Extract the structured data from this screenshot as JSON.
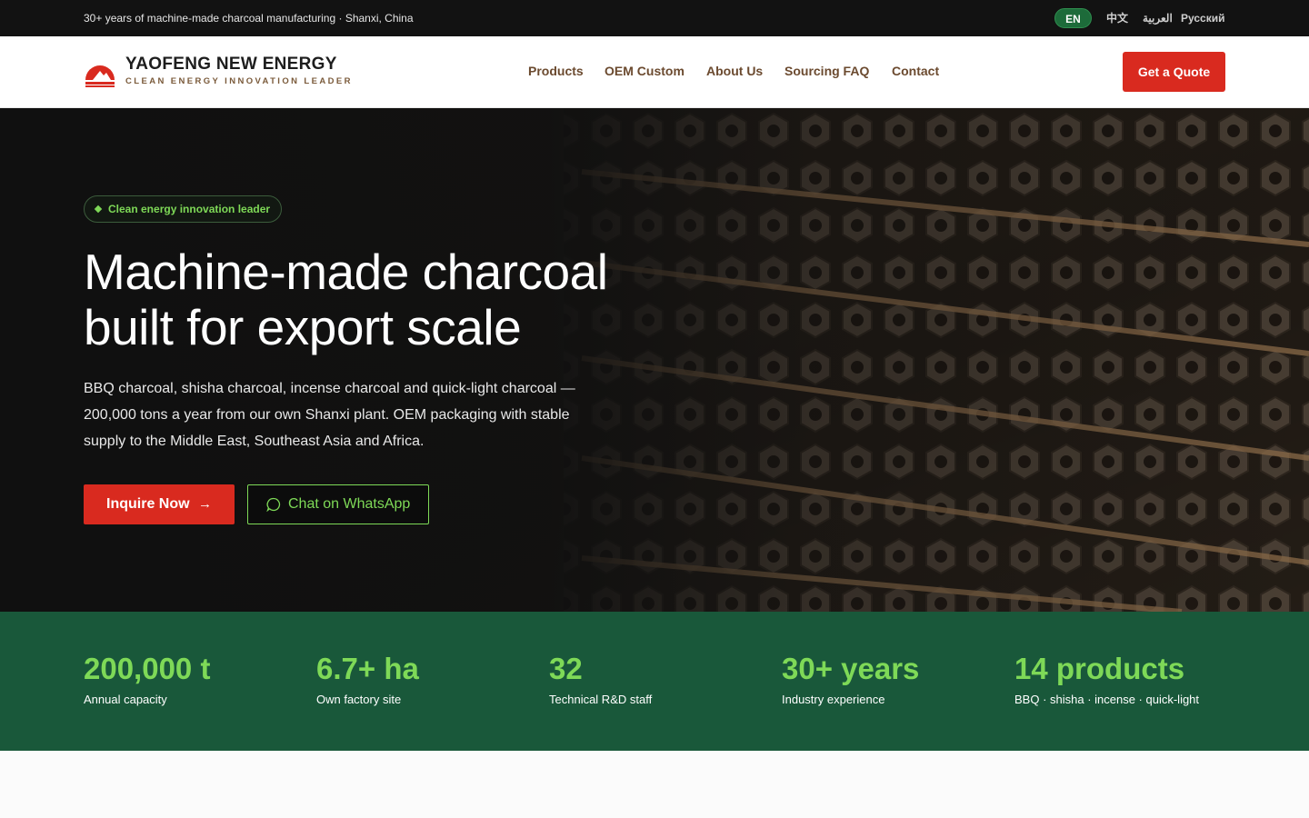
{
  "topbar": {
    "tagline": "30+ years of machine-made charcoal manufacturing · Shanxi, China",
    "languages": [
      {
        "label": "EN",
        "active": true
      },
      {
        "label": "中文",
        "active": false
      },
      {
        "label": "العربية",
        "active": false
      },
      {
        "label": "Русский",
        "active": false
      }
    ]
  },
  "header": {
    "brand_name": "YAOFENG NEW ENERGY",
    "brand_sub": "CLEAN ENERGY INNOVATION LEADER",
    "nav": [
      "Products",
      "OEM Custom",
      "About Us",
      "Sourcing FAQ",
      "Contact"
    ],
    "cta": "Get a Quote"
  },
  "hero": {
    "badge": "Clean energy innovation leader",
    "title_line1": "Machine-made charcoal",
    "title_line2": "built for export scale",
    "description": "BBQ charcoal, shisha charcoal, incense charcoal and quick-light charcoal — 200,000 tons a year from our own Shanxi plant. OEM packaging with stable supply to the Middle East, Southeast Asia and Africa.",
    "primary_button": "Inquire Now",
    "secondary_button": "Chat on WhatsApp"
  },
  "stats": [
    {
      "value": "200,000 t",
      "label": "Annual capacity"
    },
    {
      "value": "6.7+ ha",
      "label": "Own factory site"
    },
    {
      "value": "32",
      "label": "Technical R&D staff"
    },
    {
      "value": "30+ years",
      "label": "Industry experience"
    },
    {
      "value": "14 products",
      "label": "BBQ · shisha · incense · quick-light"
    }
  ],
  "colors": {
    "accent_red": "#d92a1f",
    "accent_green": "#7ed957",
    "stats_bg": "#19583a",
    "nav_text": "#6b4a2f"
  },
  "icons": {
    "logo": "sunrise-logo-icon",
    "arrow": "arrow-right-icon",
    "whatsapp": "whatsapp-chat-icon",
    "badge": "diamond-icon"
  }
}
